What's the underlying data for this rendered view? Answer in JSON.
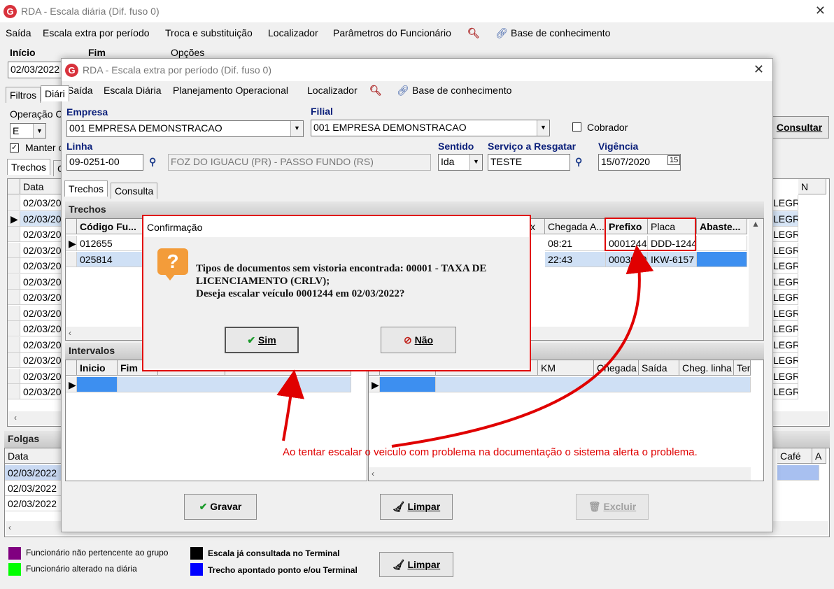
{
  "main": {
    "title": "RDA - Escala diária (Dif. fuso 0)",
    "menu": [
      "Saída",
      "Escala extra por período",
      "Troca e substituição",
      "Localizador",
      "Parâmetros do Funcionário",
      "Base de conhecimento"
    ],
    "inicio_label": "Início",
    "fim_label": "Fim",
    "opcoes_label": "Opções",
    "inicio_value": "02/03/2022",
    "tabs_top": [
      "Filtros",
      "Diári"
    ],
    "operacao_label": "Operação C",
    "operacao_value": "E",
    "manter_label": "Manter o",
    "consultar_label": "Consultar",
    "tabs_grid": [
      "Trechos",
      "C"
    ],
    "grid_header": "Data",
    "grid_dates": [
      "02/03/20",
      "02/03/20",
      "02/03/20",
      "02/03/20",
      "02/03/20",
      "02/03/20",
      "02/03/20",
      "02/03/20",
      "02/03/20",
      "02/03/20",
      "02/03/20",
      "02/03/20",
      "02/03/20"
    ],
    "right_col_header": "N",
    "right_col_values": [
      "LEGRI",
      "LEGRI",
      "LEGRI",
      "LEGRI",
      "LEGRI",
      "LEGRI",
      "LEGRI",
      "LEGRI",
      "LEGRI",
      "LEGRI",
      "LEGRI",
      "LEGRI",
      "LEGRI"
    ],
    "folgas_label": "Folgas",
    "folgas_header": "Data",
    "folgas_dates": [
      "02/03/2022",
      "02/03/2022",
      "02/03/2022"
    ],
    "cafe_header": "Café",
    "cafe_extra": "A",
    "legend": [
      {
        "color": "#800080",
        "label": "Funcionário não pertencente ao grupo"
      },
      {
        "color": "#00ff00",
        "label": "Funcionário alterado na diária"
      },
      {
        "color": "#000000",
        "label": "Escala já consultada no Terminal"
      },
      {
        "color": "#0000ff",
        "label": "Trecho apontado ponto e/ou Terminal"
      }
    ],
    "limpar_label": "Limpar"
  },
  "extra": {
    "title": "RDA - Escala extra por período (Dif. fuso 0)",
    "menu": [
      "Saída",
      "Escala Diária",
      "Planejamento Operacional",
      "Localizador",
      "Base de conhecimento"
    ],
    "empresa_label": "Empresa",
    "empresa_value": "001 EMPRESA DEMONSTRACAO",
    "filial_label": "Filial",
    "filial_value": "001 EMPRESA DEMONSTRACAO",
    "cobrador_label": "Cobrador",
    "linha_label": "Linha",
    "linha_value": "09-0251-00",
    "linha_desc": "FOZ DO IGUACU (PR) - PASSO FUNDO (RS)",
    "sentido_label": "Sentido",
    "sentido_value": "Ida",
    "servico_label": "Serviço a Resgatar",
    "servico_value": "TESTE",
    "vigencia_label": "Vigência",
    "vigencia_value": "15/07/2020",
    "tabs": [
      "Trechos",
      "Consulta"
    ],
    "trechos_label": "Trechos",
    "trechos_headers": [
      "Código Fu...",
      "x",
      "Chegada A...",
      "Prefixo",
      "Placa",
      "Abaste..."
    ],
    "trechos_rows": [
      {
        "codigo": "012655",
        "chegada": "08:21",
        "prefixo": "0001244",
        "placa": "DDD-1244"
      },
      {
        "codigo": "025814",
        "chegada": "22:43",
        "prefixo": "0003040",
        "placa": "IKW-6157"
      }
    ],
    "intervalos_label": "Intervalos",
    "intervalos_headers": [
      "Inicio",
      "Fim"
    ],
    "right_headers": [
      "KM",
      "Chegada",
      "Saída",
      "Cheg. linha",
      "Ten"
    ],
    "gravar_label": "Gravar",
    "limpar_label": "Limpar",
    "excluir_label": "Excluir"
  },
  "dialog": {
    "title": "Confirmação",
    "message_line1": "Tipos de documentos sem vistoria encontrada: 00001 - TAXA DE",
    "message_line2": "LICENCIAMENTO (CRLV);",
    "message_line3": "Deseja escalar veículo 0001244 em 02/03/2022?",
    "sim_label": "Sim",
    "nao_label": "Não"
  },
  "annotation": {
    "text": "Ao tentar escalar o veiculo com problema na documentação o sistema alerta o problema.",
    "color": "#e00000"
  }
}
